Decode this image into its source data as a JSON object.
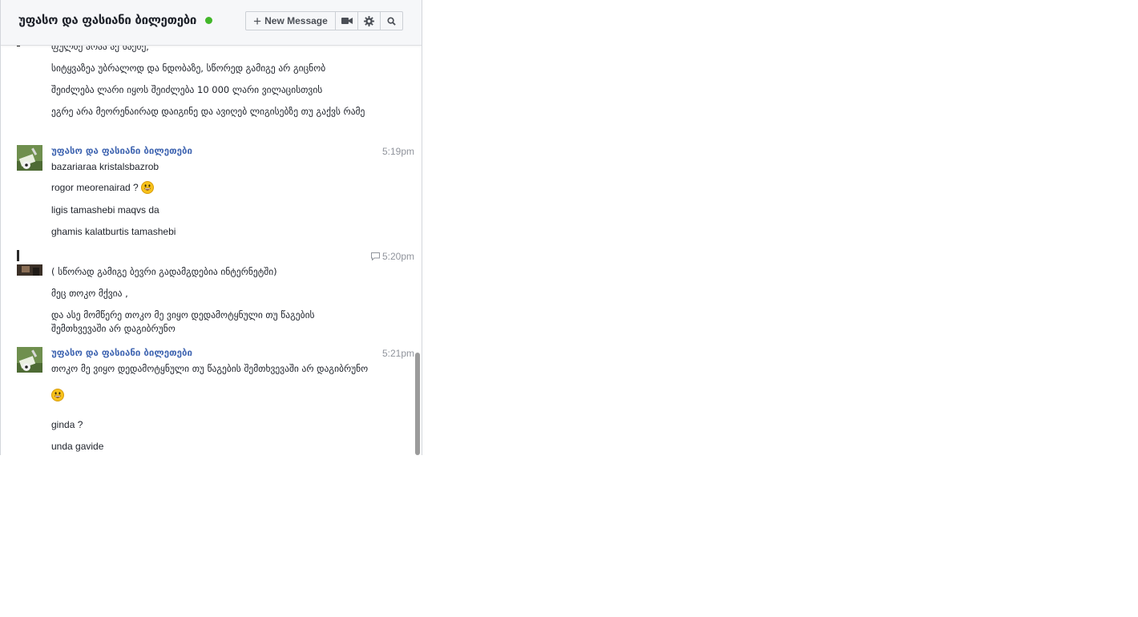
{
  "header": {
    "title": "უფასო და ფასიანი ბილეთები",
    "new_message_label": "New Message",
    "plus_glyph": "+"
  },
  "conversation": {
    "group1": {
      "messages": [
        "ფულზე არაა აქ საქმე,",
        "სიტყვაზეა უბრალოდ და ნდობაზე, სწორედ გამიგე არ გიცნობ",
        "შეიძლება ლარი იყოს შეიძლება 10 000 ლარი ვილაცისთვის",
        "ეგრე არა მეორენაირად დაიგინე და ავიღებ ლიგისებზე თუ გაქვს რამე"
      ]
    },
    "group2": {
      "sender": "უფასო და ფასიანი ბილეთები",
      "time": "5:19pm",
      "messages": [
        "bazariaraa kristalsbazrob",
        "rogor meorenairad   ?",
        "ligis tamashebi maqvs da",
        "ghamis kalatburtis tamashebi"
      ]
    },
    "group3": {
      "time": "5:20pm",
      "messages": [
        "( სწორად გამიგე ბევრი გადამგდებია ინტერნეტში)",
        "მეც თოკო მქვია ,",
        "და ასე მომწერე თოკო მე ვიყო დედამოტყნული თუ წაგების შემთხვევაში არ დაგიბრუნო"
      ]
    },
    "group4": {
      "sender": "უფასო და ფასიანი ბილეთები",
      "time": "5:21pm",
      "messages": [
        "თოკო მე ვიყო დედამოტყნული თუ წაგების შემთხვევაში არ დაგიბრუნო",
        "ginda ?",
        "unda gavide"
      ]
    }
  },
  "colors": {
    "presence": "#42b72a",
    "sender_name": "#4267b2",
    "timestamp": "#90949c"
  },
  "icons": [
    "plus-icon",
    "video-camera-icon",
    "gear-icon",
    "search-icon",
    "smiley-icon",
    "seen-icon"
  ]
}
